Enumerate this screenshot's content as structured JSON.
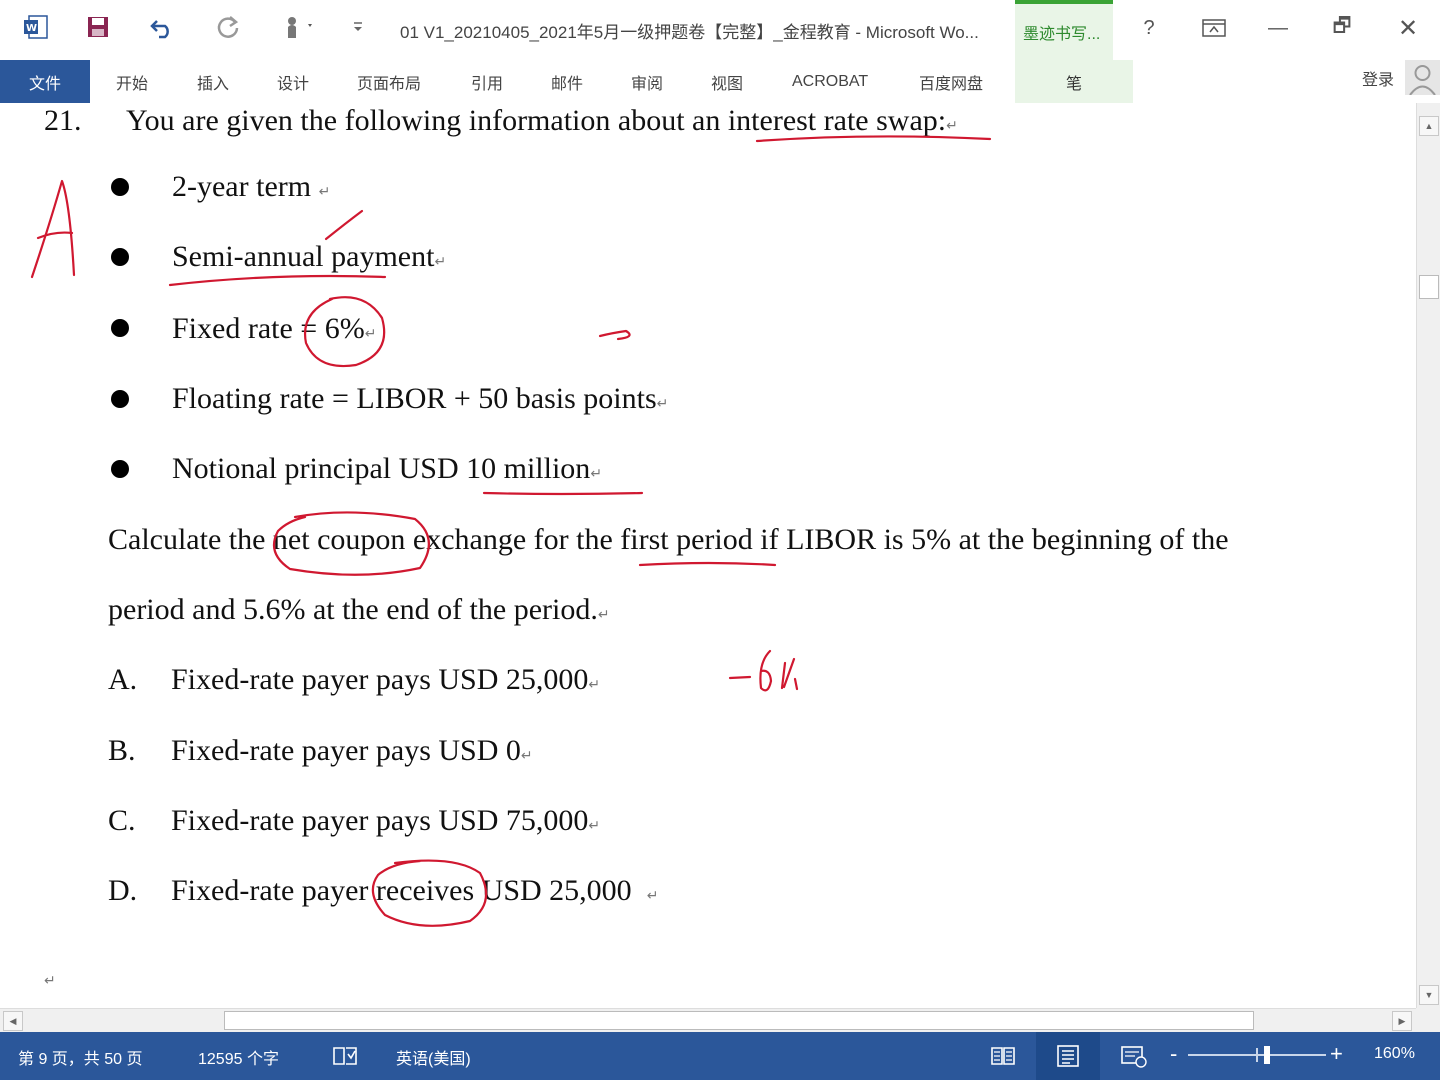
{
  "window": {
    "title": "01 V1_20210405_2021年5月一级押题卷【完整】_金程教育 - Microsoft Wo...",
    "ink_tools_tab": "墨迹书写...",
    "help": "?",
    "minimize": "—",
    "restore": "🗗",
    "close": "✕"
  },
  "ribbon": {
    "file": "文件",
    "tabs": [
      "开始",
      "插入",
      "设计",
      "页面布局",
      "引用",
      "邮件",
      "审阅",
      "视图",
      "ACROBAT",
      "百度网盘"
    ],
    "pen": "笔",
    "login": "登录"
  },
  "document": {
    "question_number": "21.",
    "question_intro": "You are given the following information about an interest rate swap:",
    "bullets": [
      "2-year term",
      "Semi-annual payment",
      "Fixed rate = 6%",
      "Floating rate = LIBOR + 50 basis points",
      "Notional principal USD 10 million"
    ],
    "prompt_line1": "Calculate the net coupon exchange for the first period if LIBOR is 5% at the beginning of the",
    "prompt_line2": "period and 5.6% at the end of the period.",
    "options": [
      {
        "letter": "A.",
        "text": "Fixed-rate payer pays USD 25,000"
      },
      {
        "letter": "B.",
        "text": "Fixed-rate payer pays USD 0"
      },
      {
        "letter": "C.",
        "text": "Fixed-rate payer pays USD 75,000"
      },
      {
        "letter": "D.",
        "text": "Fixed-rate payer receives USD 25,000"
      }
    ],
    "paragraph_mark": "↵",
    "ink_color": "#d01830"
  },
  "statusbar": {
    "page": "第 9 页，共 50 页",
    "words": "12595 个字",
    "language": "英语(美国)",
    "zoom": "160%",
    "zoom_minus": "-",
    "zoom_plus": "+"
  }
}
